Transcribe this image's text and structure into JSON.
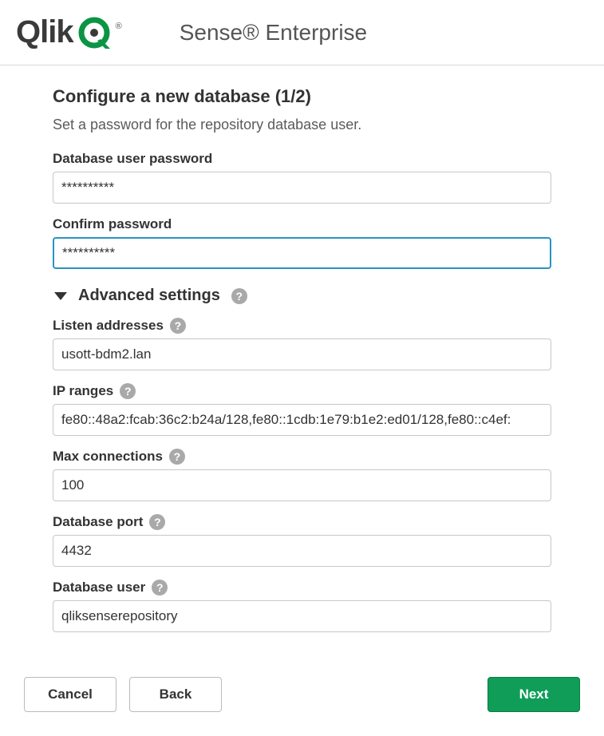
{
  "header": {
    "logo_word": "Qlik",
    "product": "Sense®  Enterprise"
  },
  "page": {
    "title": "Configure a new database (1/2)",
    "subtitle": "Set a password for the repository database user."
  },
  "fields": {
    "db_password": {
      "label": "Database user password",
      "value": "**********"
    },
    "confirm_password": {
      "label": "Confirm password",
      "value": "**********"
    }
  },
  "advanced": {
    "heading": "Advanced settings",
    "listen": {
      "label": "Listen addresses",
      "value": "usott-bdm2.lan"
    },
    "ip_ranges": {
      "label": "IP ranges",
      "value": "fe80::48a2:fcab:36c2:b24a/128,fe80::1cdb:1e79:b1e2:ed01/128,fe80::c4ef:"
    },
    "max_conn": {
      "label": "Max connections",
      "value": "100"
    },
    "db_port": {
      "label": "Database port",
      "value": "4432"
    },
    "db_user": {
      "label": "Database user",
      "value": "qliksenserepository"
    }
  },
  "buttons": {
    "cancel": "Cancel",
    "back": "Back",
    "next": "Next"
  }
}
